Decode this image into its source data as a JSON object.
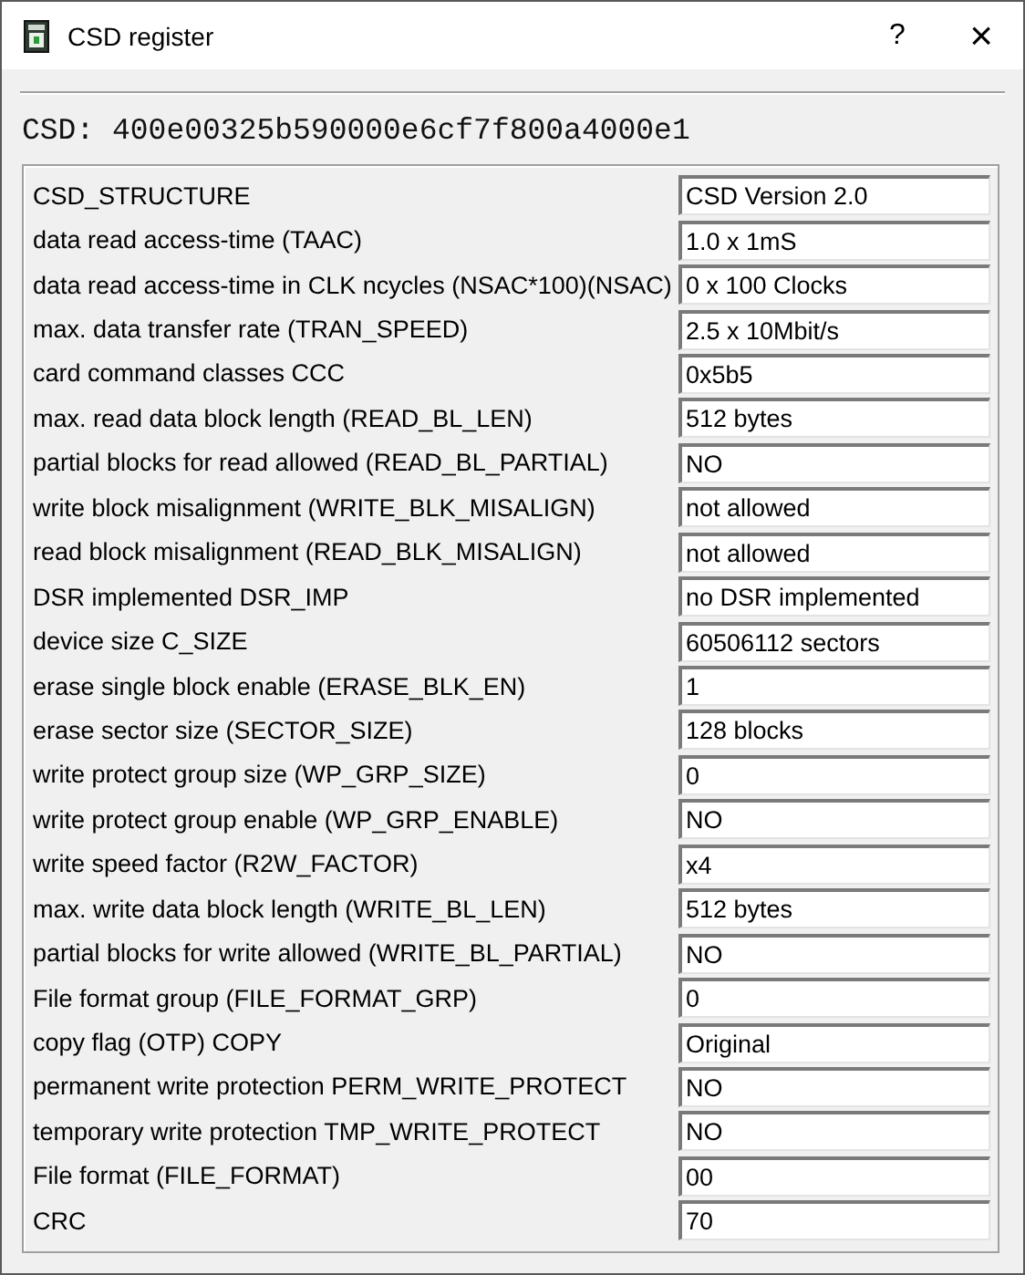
{
  "window": {
    "title": "CSD register",
    "help_button": "?",
    "close_button": "×"
  },
  "csd": "CSD: 400e00325b590000e6cf7f800a4000e1",
  "fields": [
    {
      "label": "CSD_STRUCTURE",
      "value": "CSD Version 2.0"
    },
    {
      "label": "data read access-time (TAAC)",
      "value": "1.0 x 1mS"
    },
    {
      "label": "data read access-time in CLK ncycles (NSAC*100)(NSAC)",
      "value": "0 x 100 Clocks"
    },
    {
      "label": "max. data transfer rate (TRAN_SPEED)",
      "value": "2.5 x 10Mbit/s"
    },
    {
      "label": "card command classes CCC",
      "value": "0x5b5"
    },
    {
      "label": "max. read data block length (READ_BL_LEN)",
      "value": "512 bytes"
    },
    {
      "label": "partial blocks for read allowed (READ_BL_PARTIAL)",
      "value": "NO"
    },
    {
      "label": "write block misalignment (WRITE_BLK_MISALIGN)",
      "value": "not allowed"
    },
    {
      "label": "read block misalignment (READ_BLK_MISALIGN)",
      "value": "not allowed"
    },
    {
      "label": "DSR implemented DSR_IMP",
      "value": "no DSR implemented"
    },
    {
      "label": "device size C_SIZE",
      "value": "60506112 sectors"
    },
    {
      "label": "erase single block enable (ERASE_BLK_EN)",
      "value": "1"
    },
    {
      "label": "erase sector size (SECTOR_SIZE)",
      "value": "128 blocks"
    },
    {
      "label": "write protect group size (WP_GRP_SIZE)",
      "value": "0"
    },
    {
      "label": "write protect group enable (WP_GRP_ENABLE)",
      "value": "NO"
    },
    {
      "label": "write speed factor (R2W_FACTOR)",
      "value": "x4"
    },
    {
      "label": "max. write data block length (WRITE_BL_LEN)",
      "value": "512 bytes"
    },
    {
      "label": "partial blocks for write allowed (WRITE_BL_PARTIAL)",
      "value": "NO"
    },
    {
      "label": "File format group (FILE_FORMAT_GRP)",
      "value": "0"
    },
    {
      "label": "copy flag (OTP) COPY",
      "value": "Original"
    },
    {
      "label": "permanent write protection PERM_WRITE_PROTECT",
      "value": "NO"
    },
    {
      "label": "temporary write protection TMP_WRITE_PROTECT",
      "value": "NO"
    },
    {
      "label": "File format (FILE_FORMAT)",
      "value": "00"
    },
    {
      "label": "CRC",
      "value": "70"
    }
  ]
}
